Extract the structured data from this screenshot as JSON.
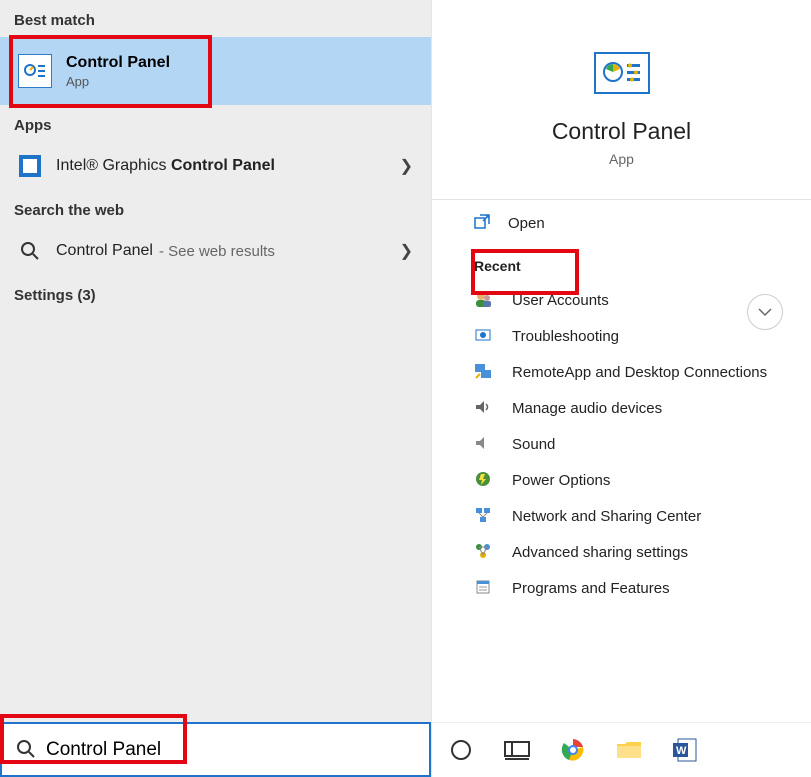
{
  "left": {
    "best_match_label": "Best match",
    "best_match": {
      "title": "Control Panel",
      "sub": "App"
    },
    "apps_label": "Apps",
    "apps_item_prefix": "Intel® Graphics ",
    "apps_item_bold": "Control Panel",
    "web_label": "Search the web",
    "web_item": "Control Panel",
    "web_suffix": "- See web results",
    "settings_label": "Settings (3)",
    "search_value": "Control Panel"
  },
  "right": {
    "title": "Control Panel",
    "sub": "App",
    "open": "Open",
    "recent_label": "Recent",
    "recent": [
      "User Accounts",
      "Troubleshooting",
      "RemoteApp and Desktop Connections",
      "Manage audio devices",
      "Sound",
      "Power Options",
      "Network and Sharing Center",
      "Advanced sharing settings",
      "Programs and Features"
    ]
  }
}
